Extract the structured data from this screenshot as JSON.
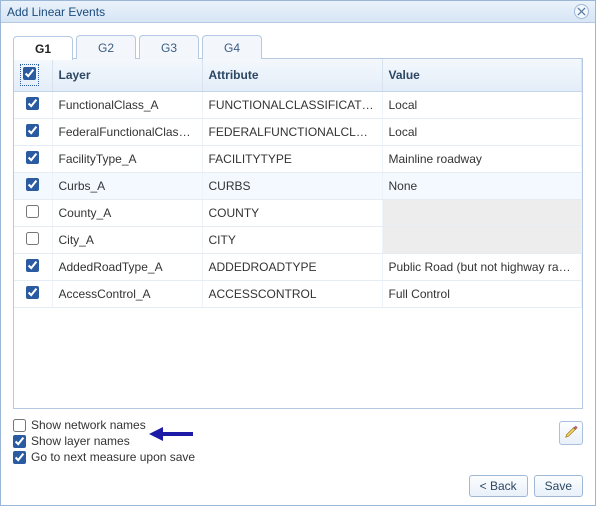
{
  "window": {
    "title": "Add Linear Events"
  },
  "tabs": [
    {
      "label": "G1",
      "active": true
    },
    {
      "label": "G2",
      "active": false
    },
    {
      "label": "G3",
      "active": false
    },
    {
      "label": "G4",
      "active": false
    }
  ],
  "table": {
    "headers": {
      "layer": "Layer",
      "attribute": "Attribute",
      "value": "Value"
    },
    "header_checked": true,
    "rows": [
      {
        "checked": true,
        "layer": "FunctionalClass_A",
        "attribute": "FUNCTIONALCLASSIFICATION",
        "value": "Local",
        "value_enabled": true
      },
      {
        "checked": true,
        "layer": "FederalFunctionalClass_A",
        "attribute": "FEDERALFUNCTIONALCLASS",
        "value": "Local",
        "value_enabled": true
      },
      {
        "checked": true,
        "layer": "FacilityType_A",
        "attribute": "FACILITYTYPE",
        "value": "Mainline roadway",
        "value_enabled": true
      },
      {
        "checked": true,
        "layer": "Curbs_A",
        "attribute": "CURBS",
        "value": "None",
        "value_enabled": true,
        "highlight": true
      },
      {
        "checked": false,
        "layer": "County_A",
        "attribute": "COUNTY",
        "value": "",
        "value_enabled": false
      },
      {
        "checked": false,
        "layer": "City_A",
        "attribute": "CITY",
        "value": "",
        "value_enabled": false
      },
      {
        "checked": true,
        "layer": "AddedRoadType_A",
        "attribute": "ADDEDROADTYPE",
        "value": "Public Road (but not highway ramp)",
        "value_enabled": true
      },
      {
        "checked": true,
        "layer": "AccessControl_A",
        "attribute": "ACCESSCONTROL",
        "value": "Full Control",
        "value_enabled": true
      }
    ]
  },
  "options": {
    "show_network_names": {
      "label": "Show network names",
      "checked": false
    },
    "show_layer_names": {
      "label": "Show layer names",
      "checked": true
    },
    "go_next_measure": {
      "label": "Go to next measure upon save",
      "checked": true
    }
  },
  "buttons": {
    "back": "< Back",
    "save": "Save"
  },
  "colors": {
    "accent": "#2a5aa0",
    "arrow": "#1c1aa6"
  }
}
